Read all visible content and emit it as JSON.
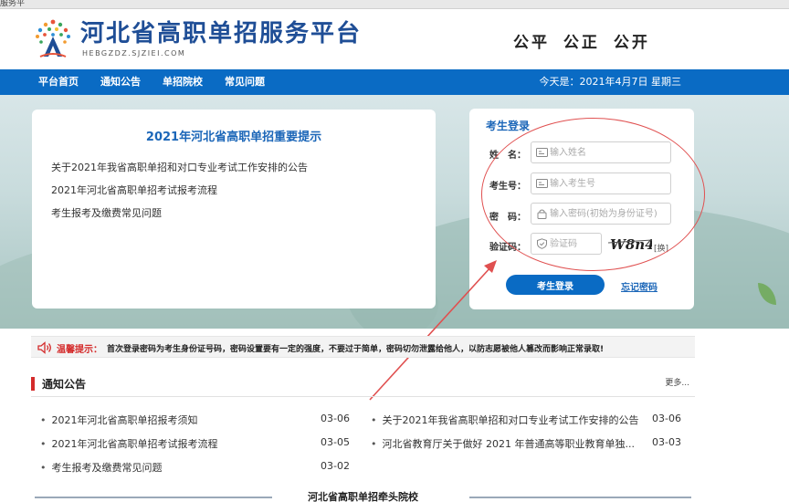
{
  "browser": {
    "tab_title": "服务平"
  },
  "header": {
    "site_title": "河北省高职单招服务平台",
    "site_domain": "HEBGZDZ.SJZIEI.COM",
    "slogan": "公平 公正 公开"
  },
  "nav": {
    "items": [
      {
        "label": "平台首页"
      },
      {
        "label": "通知公告"
      },
      {
        "label": "单招院校"
      },
      {
        "label": "常见问题"
      }
    ],
    "date_text": "今天是：2021年4月7日 星期三"
  },
  "notice": {
    "title": "2021年河北省高职单招重要提示",
    "links": [
      "关于2021年我省高职单招和对口专业考试工作安排的公告",
      "2021年河北省高职单招考试报考流程",
      "考生报考及缴费常见问题"
    ]
  },
  "login": {
    "title": "考生登录",
    "name_label": "姓　名：",
    "name_placeholder": "输入姓名",
    "id_label": "考生号：",
    "id_placeholder": "输入考生号",
    "password_label": "密　码：",
    "password_placeholder": "输入密码(初始为身份证号)",
    "captcha_label": "验证码：",
    "captcha_placeholder": "验证码",
    "captcha_text": "W8n4",
    "refresh_label": "[换]",
    "submit_label": "考生登录",
    "forgot_label": "忘记密码"
  },
  "warning": {
    "label": "温馨提示：",
    "text": "首次登录密码为考生身份证号码，密码设置要有一定的强度，不要过于简单，密码切勿泄露给他人，以防志愿被他人篡改而影响正常录取!"
  },
  "news": {
    "title": "通知公告",
    "more": "更多...",
    "left": [
      {
        "title": "2021年河北省高职单招报考须知",
        "date": "03-06"
      },
      {
        "title": "2021年河北省高职单招考试报考流程",
        "date": "03-05"
      },
      {
        "title": "考生报考及缴费常见问题",
        "date": "03-02"
      }
    ],
    "right": [
      {
        "title": "关于2021年我省高职单招和对口专业考试工作安排的公告",
        "date": "03-06"
      },
      {
        "title": "河北省教育厅关于做好 2021 年普通高等职业教育单独...",
        "date": "03-03"
      }
    ]
  },
  "footer": {
    "section_title": "河北省高职单招牵头院校"
  },
  "colors": {
    "brand_blue": "#0a6bc4",
    "title_blue": "#1f4e96",
    "warning_red": "#d42b2b",
    "annotation_red": "#e05050"
  }
}
